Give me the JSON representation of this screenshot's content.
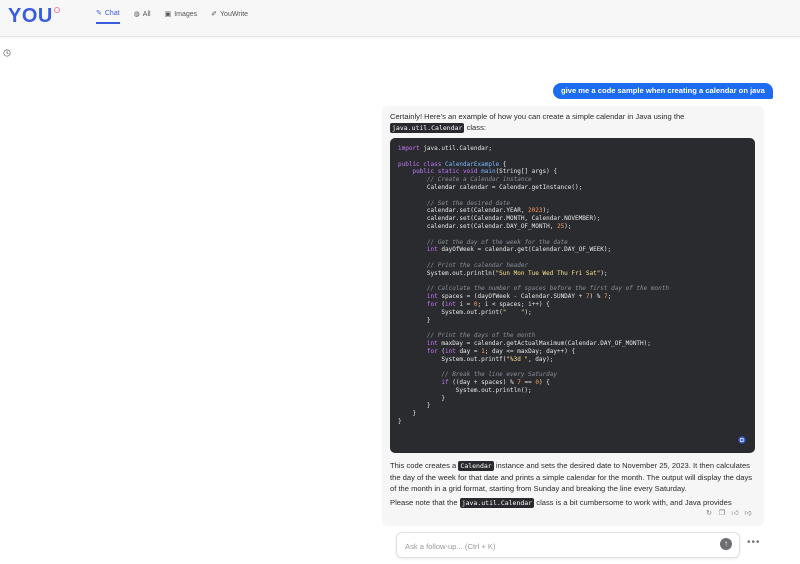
{
  "header": {
    "logo": "YOU",
    "tabs": [
      {
        "label": "Chat",
        "icon": "chat-icon",
        "active": true
      },
      {
        "label": "All",
        "icon": "globe-icon",
        "active": false
      },
      {
        "label": "Images",
        "icon": "image-icon",
        "active": false
      },
      {
        "label": "YouWrite",
        "icon": "pen-icon",
        "active": false
      }
    ]
  },
  "sidebar": {
    "history_icon": "history-icon"
  },
  "conversation": {
    "user_message": "give me a code sample when creating a calendar on java",
    "answer": {
      "intro_text": "Certainly! Here's an example of how you can create a simple calendar in Java using the",
      "intro_code": "java.util.Calendar",
      "intro_suffix": "class:",
      "para1_a": "This code creates a",
      "para1_code": "Calendar",
      "para1_b": "instance and sets the desired date to November 25, 2023. It then calculates the day of the week for that date and prints a simple calendar for the month. The output will display the days of the month in a grid format, starting from Sunday and breaking the line every Saturday.",
      "para2_a": "Please note that the",
      "para2_code": "java.util.Calendar",
      "para2_b": "class is a bit cumbersome to work with, and Java provides"
    }
  },
  "composer": {
    "placeholder": "Ask a follow-up... (Ctrl + K)",
    "value": ""
  },
  "colors": {
    "accent": "#1c6bf0",
    "code_bg": "#2a2b2f"
  }
}
